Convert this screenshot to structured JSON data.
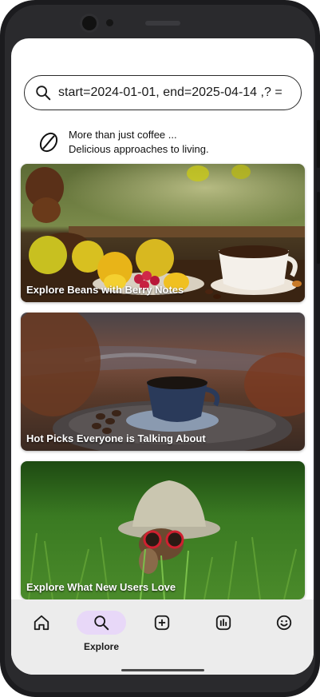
{
  "search": {
    "value": "= ?, start=2024-01-01, end=2025-04-14",
    "placeholder": ""
  },
  "tagline": {
    "line1": "More than just coffee ...",
    "line2": "Delicious approaches to living."
  },
  "cards": [
    {
      "title": "Explore Beans with Berry Notes"
    },
    {
      "title": "Hot Picks Everyone is Talking About"
    },
    {
      "title": "Explore What New Users Love"
    }
  ],
  "nav": {
    "items": [
      {
        "label": "",
        "icon": "home-icon"
      },
      {
        "label": "Explore",
        "icon": "search-icon",
        "active": true
      },
      {
        "label": "",
        "icon": "add-icon"
      },
      {
        "label": "",
        "icon": "chart-icon"
      },
      {
        "label": "",
        "icon": "smiley-icon"
      }
    ]
  },
  "colors": {
    "nav_background": "#ececec",
    "active_pill": "#e8d8f8"
  }
}
